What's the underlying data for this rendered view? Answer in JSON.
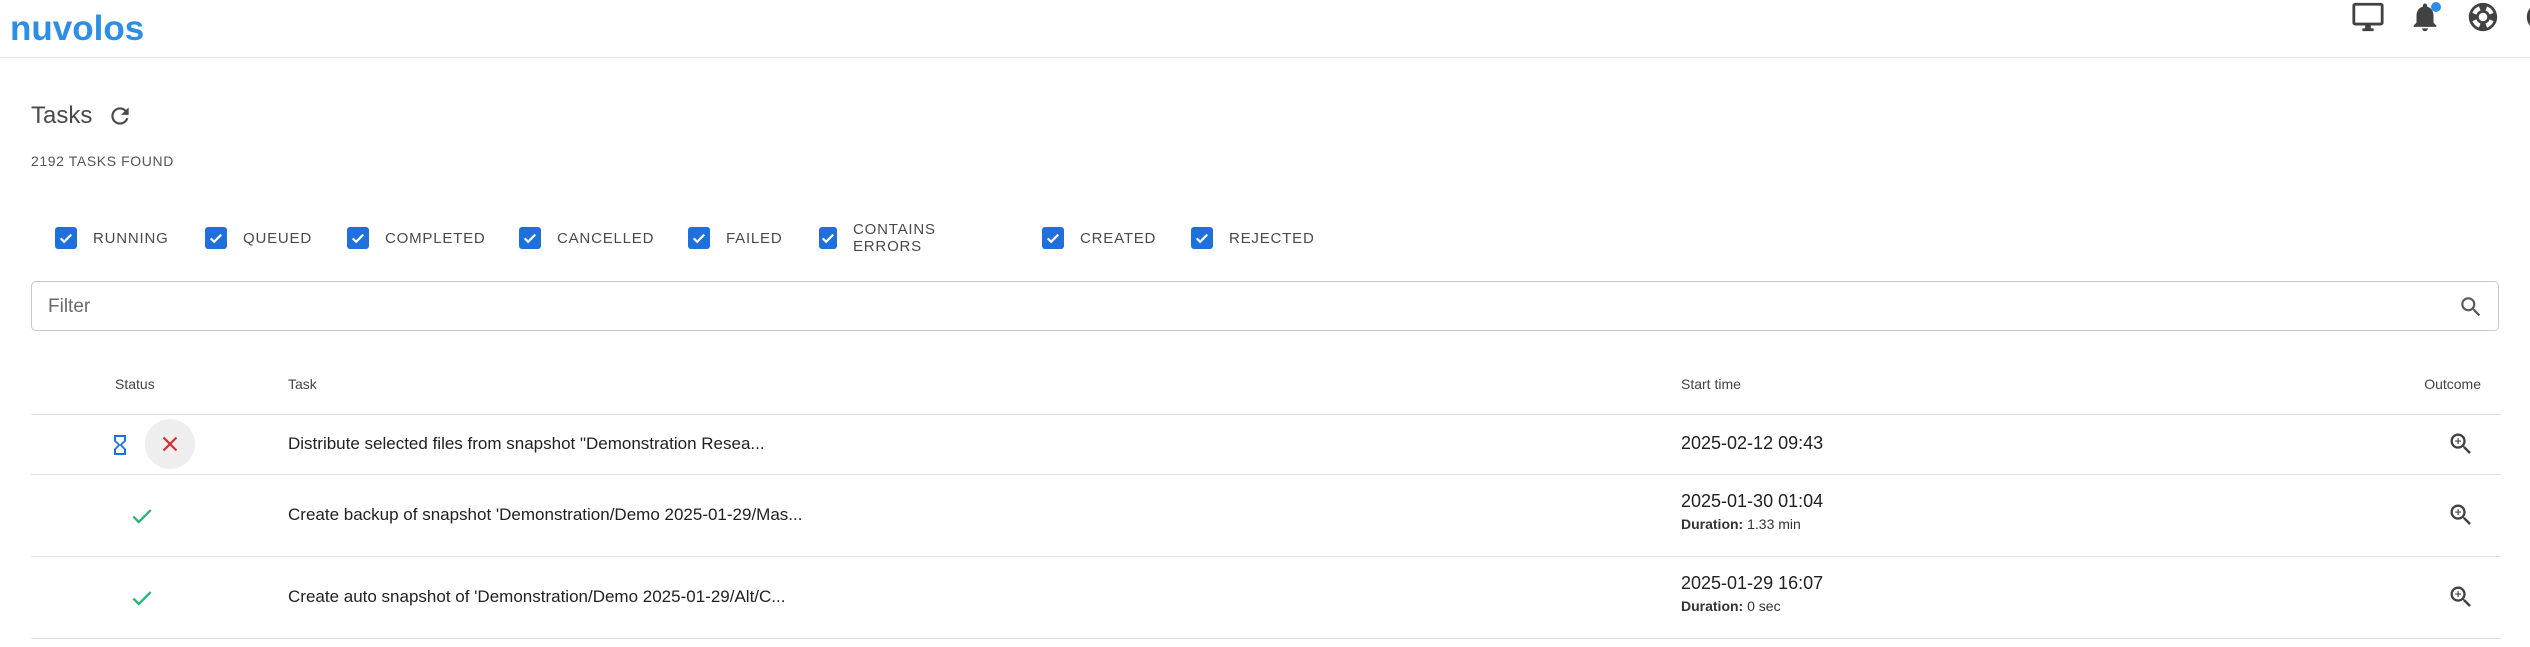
{
  "app": {
    "logo_text": "nuvolos"
  },
  "header": {
    "icons": [
      "monitor-icon",
      "bell-icon",
      "lifebuoy-icon",
      "account-icon"
    ],
    "colors": {
      "accent": "#2d8ee6"
    }
  },
  "page": {
    "title": "Tasks",
    "count_label": "2192 TASKS FOUND"
  },
  "filters": [
    {
      "label": "RUNNING",
      "checked": true
    },
    {
      "label": "QUEUED",
      "checked": true
    },
    {
      "label": "COMPLETED",
      "checked": true
    },
    {
      "label": "CANCELLED",
      "checked": true
    },
    {
      "label": "FAILED",
      "checked": true
    },
    {
      "label": "CONTAINS ERRORS",
      "checked": true
    },
    {
      "label": "CREATED",
      "checked": true
    },
    {
      "label": "REJECTED",
      "checked": true
    }
  ],
  "search": {
    "placeholder": "Filter",
    "value": ""
  },
  "table": {
    "columns": {
      "status": "Status",
      "task": "Task",
      "start": "Start time",
      "outcome": "Outcome"
    },
    "rows": [
      {
        "status": "running",
        "task": "Distribute selected files from snapshot \"Demonstration Resea...",
        "start": "2025-02-12 09:43",
        "duration_label": "",
        "duration": ""
      },
      {
        "status": "completed",
        "task": "Create backup of snapshot 'Demonstration/Demo 2025-01-29/Mas...",
        "start": "2025-01-30 01:04",
        "duration_label": "Duration:",
        "duration": "1.33 min"
      },
      {
        "status": "completed",
        "task": "Create auto snapshot of 'Demonstration/Demo 2025-01-29/Alt/C...",
        "start": "2025-01-29 16:07",
        "duration_label": "Duration:",
        "duration": "0 sec"
      }
    ]
  }
}
